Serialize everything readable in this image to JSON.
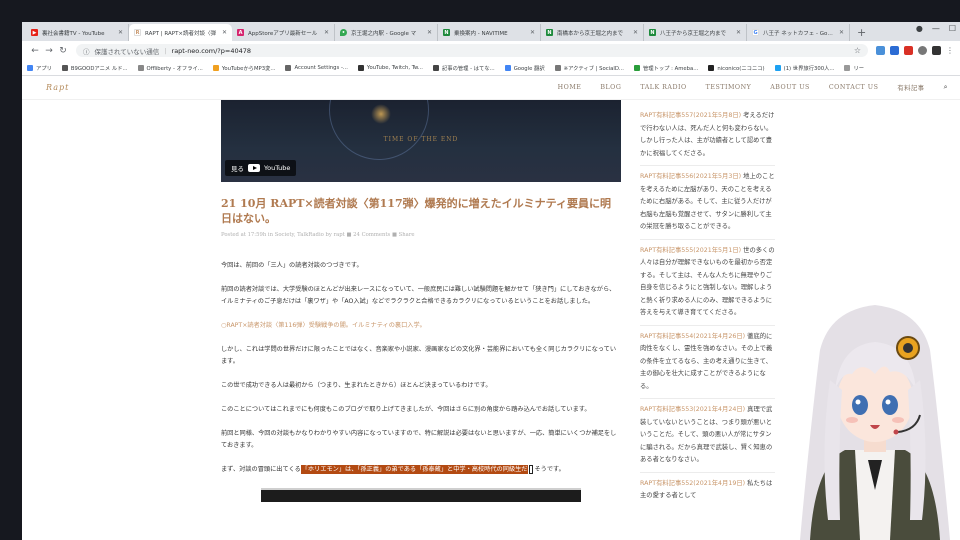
{
  "tabs": [
    {
      "title": "裏社会書籍TV - YouTube",
      "icon_color": "#e62117",
      "icon": "youtube-icon",
      "active": false
    },
    {
      "title": "RAPT | RAPT×読者対談〈弾",
      "icon_color": "#c8966a",
      "icon": "rapt-icon",
      "active": true
    },
    {
      "title": "AppStoreアプリ最新セール",
      "icon_color": "#d6246e",
      "icon": "appstore-icon",
      "active": false
    },
    {
      "title": "京王堀之内駅 - Google マ",
      "icon_color": "#34a853",
      "icon": "maps-icon",
      "active": false
    },
    {
      "title": "乗換案内 - NAVITIME",
      "icon_color": "#1e8a3c",
      "icon": "navitime-icon",
      "active": false
    },
    {
      "title": "南橋本から京王堀之内まで",
      "icon_color": "#1e8a3c",
      "icon": "navitime-icon",
      "active": false
    },
    {
      "title": "八王子から京王堀之内まで",
      "icon_color": "#1e8a3c",
      "icon": "navitime-icon",
      "active": false
    },
    {
      "title": "八王子 ネットカフェ - Google",
      "icon_color": "#4285f4",
      "icon": "google-icon",
      "active": false
    }
  ],
  "address": {
    "security": "保護されていない通信",
    "url": "rapt-neo.com/?p=40478"
  },
  "bookmarks": [
    {
      "label": "アプリ",
      "color": "#4285f4"
    },
    {
      "label": "B9GOODアニメ ルド...",
      "color": "#555"
    },
    {
      "label": "Offliberty - オフライ...",
      "color": "#888"
    },
    {
      "label": "YouTubeからMP3変...",
      "color": "#f0a020"
    },
    {
      "label": "Account Settings -...",
      "color": "#666"
    },
    {
      "label": "YouTube, Twitch, Tw...",
      "color": "#333"
    },
    {
      "label": "記事の管理 - はてな...",
      "color": "#444"
    },
    {
      "label": "Google 翻訳",
      "color": "#4285f4"
    },
    {
      "label": "※アクティブ | SocialD...",
      "color": "#777"
    },
    {
      "label": "管理トップ : Ameba...",
      "color": "#2a9d3a"
    },
    {
      "label": "niconico(ニコニコ)",
      "color": "#222"
    },
    {
      "label": "(1) 世界旅行300人...",
      "color": "#1da1f2"
    },
    {
      "label": "リー",
      "color": "#999"
    }
  ],
  "site": {
    "logo": "Rapt",
    "nav": [
      "HOME",
      "BLOG",
      "TALK RADIO",
      "TESTIMONY",
      "ABOUT US",
      "CONTACT US",
      "有料記事"
    ]
  },
  "video": {
    "caption": "TIME OF THE END",
    "watch_label": "見る",
    "yt_label": "YouTube"
  },
  "article": {
    "date": "21 10月",
    "title": "RAPT×読者対談〈第117弾〉爆発的に増えたイルミナティ要員に明日はない。",
    "meta": "Posted at 17:59h in Society, TalkRadio by rapt  ■ 24 Comments  ■ Share",
    "p1": "今回は、前回の「三人」の読者対談のつづきです。",
    "p2": "前回の読者対談では、大学受験のほとんどが出来レースになっていて、一般庶民には難しい試験問題を解かせて「狭き門」にしておきながら、イルミナティのご子息だけは「裏ワザ」や「AO入試」などでラクラクと合格できるカラクリになっているということをお話しました。",
    "link": "○RAPT×読者対談〈第116弾〉受験戦争の闇。イルミナティの裏口入学。",
    "p3": "しかし、これは学問の世界だけに限ったことではなく、音楽家や小説家、漫画家などの文化界・芸能界においても全く同じカラクリになっています。",
    "p4": "この世で成功できる人は最初から（つまり、生まれたときから）ほとんど決まっているわけです。",
    "p5": "このことについてはこれまでにも何度もこのブログで取り上げてきましたが、今回はさらに別の角度から踏み込んでお話しています。",
    "p6": "前回と同様、今回の対談もかなりわかりやすい内容になっていますので、特に解説は必要はないと思いますが、一応、簡単にいくつか補足をしておきます。",
    "p7_pre": "まず、対談の冒頭に出てくる",
    "p7_hl": "「ホリエモン」は、「孫正義」の弟である「孫泰蔵」と中学・高校時代の同級生だ",
    "p7_post": "そうです。"
  },
  "sidebar": [
    {
      "link": "RAPT有料記事557(2021年5月8日)",
      "text": "考えるだけで行わない人は、死んだ人と何も変わらない。しかし行った人は、主が功績者として認めて豊かに祝福してくださる。"
    },
    {
      "link": "RAPT有料記事556(2021年5月3日)",
      "text": "地上のことを考えるために左脳があり、天のことを考えるために右脳がある。そして、主に従う人だけが右脳も左脳も覚醒させて、サタンに勝利して主の栄冠を勝ち取ることができる。"
    },
    {
      "link": "RAPT有料記事555(2021年5月1日)",
      "text": "世の多くの人々は自分が理解できないものを最初から否定する。そして主は、そんな人たちに無理やりご自身を信じるようにと強制しない。理解しようと熱く祈り求める人にのみ、理解できるように答えを与えて導き育ててくださる。"
    },
    {
      "link": "RAPT有料記事554(2021年4月26日)",
      "text": "徹底的に肉性をなくし、霊性を強めなさい。その上で義の条件を立てるなら、主の考え通りに生きて、主の御心を壮大に成すことができるようになる。"
    },
    {
      "link": "RAPT有料記事553(2021年4月24日)",
      "text": "真理で武装していないということは、つまり頭が悪いということだ。そして、頭の悪い人が常にサタンに騙される。だから真理で武装し、賢く知恵のある者となりなさい。"
    },
    {
      "link": "RAPT有料記事552(2021年4月19日)",
      "text": "私たちは主の愛する者として"
    }
  ]
}
